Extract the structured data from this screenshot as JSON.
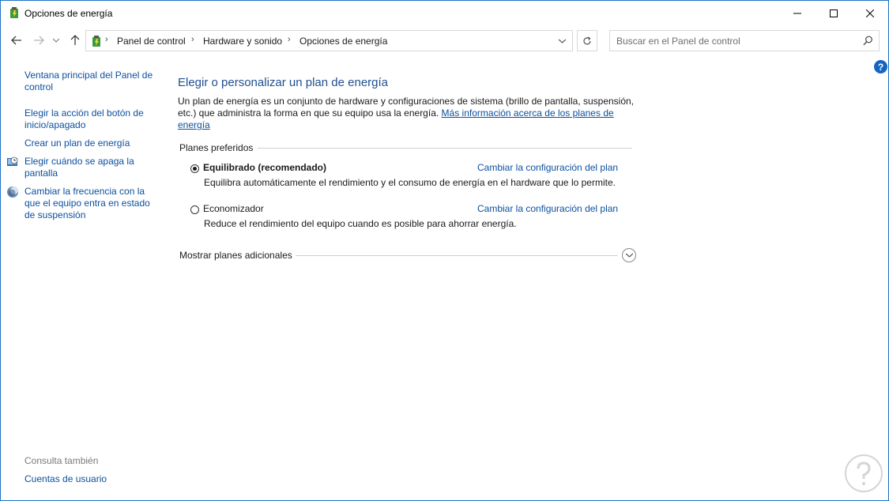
{
  "window": {
    "title": "Opciones de energía"
  },
  "address": {
    "crumbs": [
      "Panel de control",
      "Hardware y sonido",
      "Opciones de energía"
    ],
    "separator": "›"
  },
  "search": {
    "placeholder": "Buscar en el Panel de control"
  },
  "help": {
    "label": "?"
  },
  "left_pane": {
    "links": [
      "Ventana principal del Panel de control",
      "Elegir la acción del botón de inicio/apagado",
      "Crear un plan de energía",
      "Elegir cuándo se apaga la pantalla",
      "Cambiar la frecuencia con la que el equipo entra en estado de suspensión"
    ],
    "see_also_label": "Consulta también",
    "see_also_links": [
      "Cuentas de usuario"
    ]
  },
  "main": {
    "heading": "Elegir o personalizar un plan de energía",
    "description": "Un plan de energía es un conjunto de hardware y configuraciones de sistema (brillo de pantalla, suspensión, etc.) que administra la forma en que su equipo usa la energía.",
    "more_info_link": "Más información acerca de los planes de energía",
    "preferred_label": "Planes preferidos",
    "plans": [
      {
        "name": "Equilibrado (recomendado)",
        "selected": true,
        "link": "Cambiar la configuración del plan",
        "description": "Equilibra automáticamente el rendimiento y el consumo de energía en el hardware que lo permite."
      },
      {
        "name": "Economizador",
        "selected": false,
        "link": "Cambiar la configuración del plan",
        "description": "Reduce el rendimiento del equipo cuando es posible para ahorrar energía."
      }
    ],
    "show_more_label": "Mostrar planes adicionales"
  },
  "colors": {
    "link": "#0b4f9e",
    "heading": "#1f4f8f",
    "accent": "#1565c0",
    "border": "#1e72c6"
  }
}
